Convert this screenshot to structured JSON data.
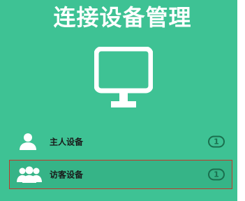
{
  "header": {
    "title": "连接设备管理"
  },
  "icons": {
    "monitor": "monitor-icon",
    "host": "user-icon",
    "guest": "users-icon"
  },
  "devices": [
    {
      "label": "主人设备",
      "count": "1"
    },
    {
      "label": "访客设备",
      "count": "1",
      "selected": true
    }
  ],
  "colors": {
    "panel": "#3ec294",
    "selected_row": "#36b487",
    "selected_border": "#c0392b",
    "badge": "#1a6f4e"
  }
}
